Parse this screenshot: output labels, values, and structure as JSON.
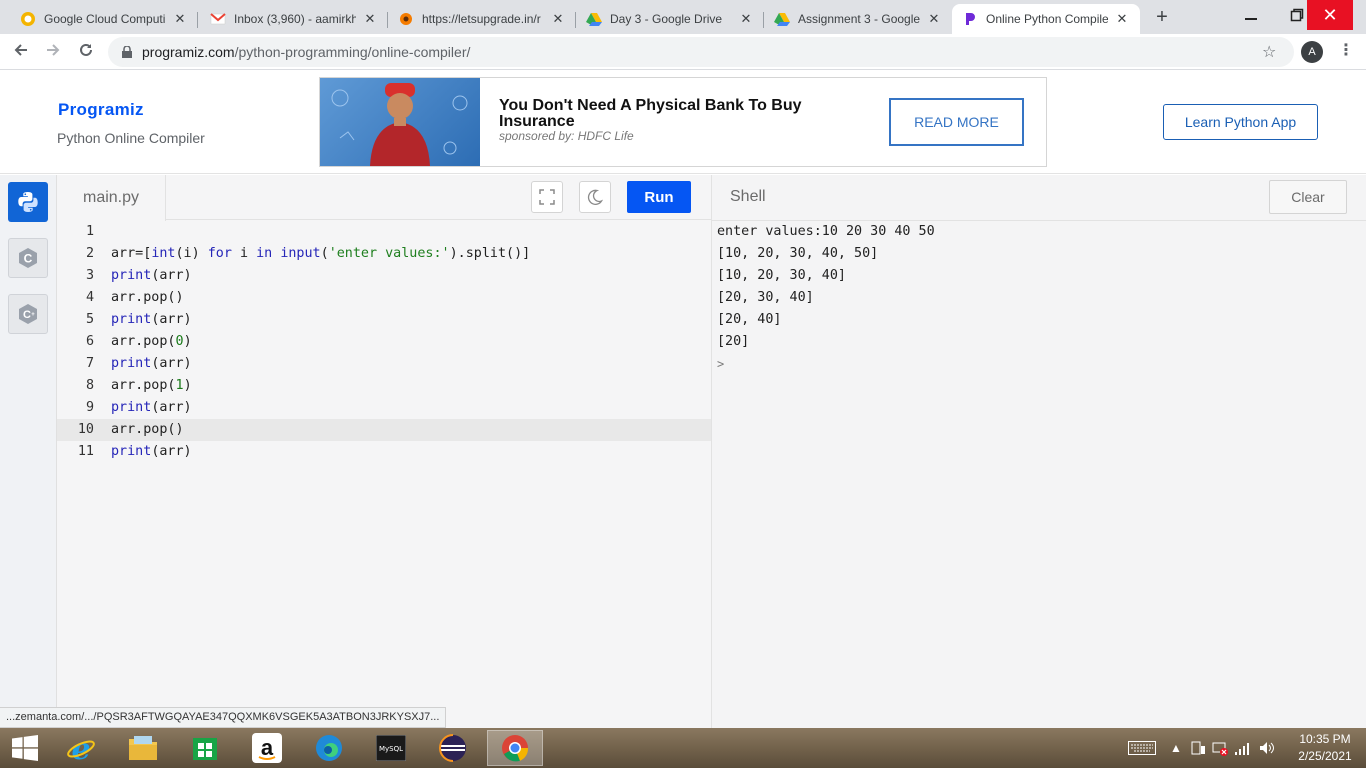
{
  "browser": {
    "tabs": [
      {
        "title": "Google Cloud Computi",
        "icon": "google-cloud-favicon"
      },
      {
        "title": "Inbox (3,960) - aamirkh",
        "icon": "gmail-favicon"
      },
      {
        "title": "https://letsupgrade.in/r",
        "icon": "letsupgrade-favicon"
      },
      {
        "title": "Day 3 - Google Drive",
        "icon": "google-drive-favicon"
      },
      {
        "title": "Assignment 3 - Google",
        "icon": "google-drive-favicon"
      },
      {
        "title": "Online Python Compile",
        "icon": "programiz-favicon",
        "active": true
      }
    ],
    "new_tab": "+",
    "url_host": "programiz.com",
    "url_path": "/python-programming/online-compiler/",
    "profile_initial": "A"
  },
  "site": {
    "logo": "Programiz",
    "subtitle": "Python Online Compiler",
    "ad": {
      "headline": "You Don't Need A Physical Bank To Buy Insurance",
      "sponsor": "sponsored by: HDFC Life",
      "cta": "READ MORE"
    },
    "learn_app": "Learn Python App"
  },
  "editor": {
    "filename": "main.py",
    "run_label": "Run",
    "lines": [
      {
        "n": "1",
        "code": ""
      },
      {
        "n": "2",
        "code": "arr=[int(i) for i in input('enter values:').split()]"
      },
      {
        "n": "3",
        "code": "print(arr)"
      },
      {
        "n": "4",
        "code": "arr.pop()"
      },
      {
        "n": "5",
        "code": "print(arr)"
      },
      {
        "n": "6",
        "code": "arr.pop(0)"
      },
      {
        "n": "7",
        "code": "print(arr)"
      },
      {
        "n": "8",
        "code": "arr.pop(1)"
      },
      {
        "n": "9",
        "code": "print(arr)"
      },
      {
        "n": "10",
        "code": "arr.pop()"
      },
      {
        "n": "11",
        "code": "print(arr)"
      }
    ]
  },
  "shell": {
    "title": "Shell",
    "clear_label": "Clear",
    "output": [
      "enter values:10 20 30 40 50",
      "[10, 20, 30, 40, 50]",
      "[10, 20, 30, 40]",
      "[20, 30, 40]",
      "[20, 40]",
      "[20]"
    ],
    "prompt": ">"
  },
  "status_link": "...zemanta.com/.../PQSR3AFTWGQAYAE347QQXMK6VSGEK5A3ATBON3JRKYSXJ7...",
  "taskbar": {
    "time": "10:35 PM",
    "date": "2/25/2021"
  },
  "colors": {
    "accent": "#0556f3",
    "close_button": "#e81123"
  }
}
